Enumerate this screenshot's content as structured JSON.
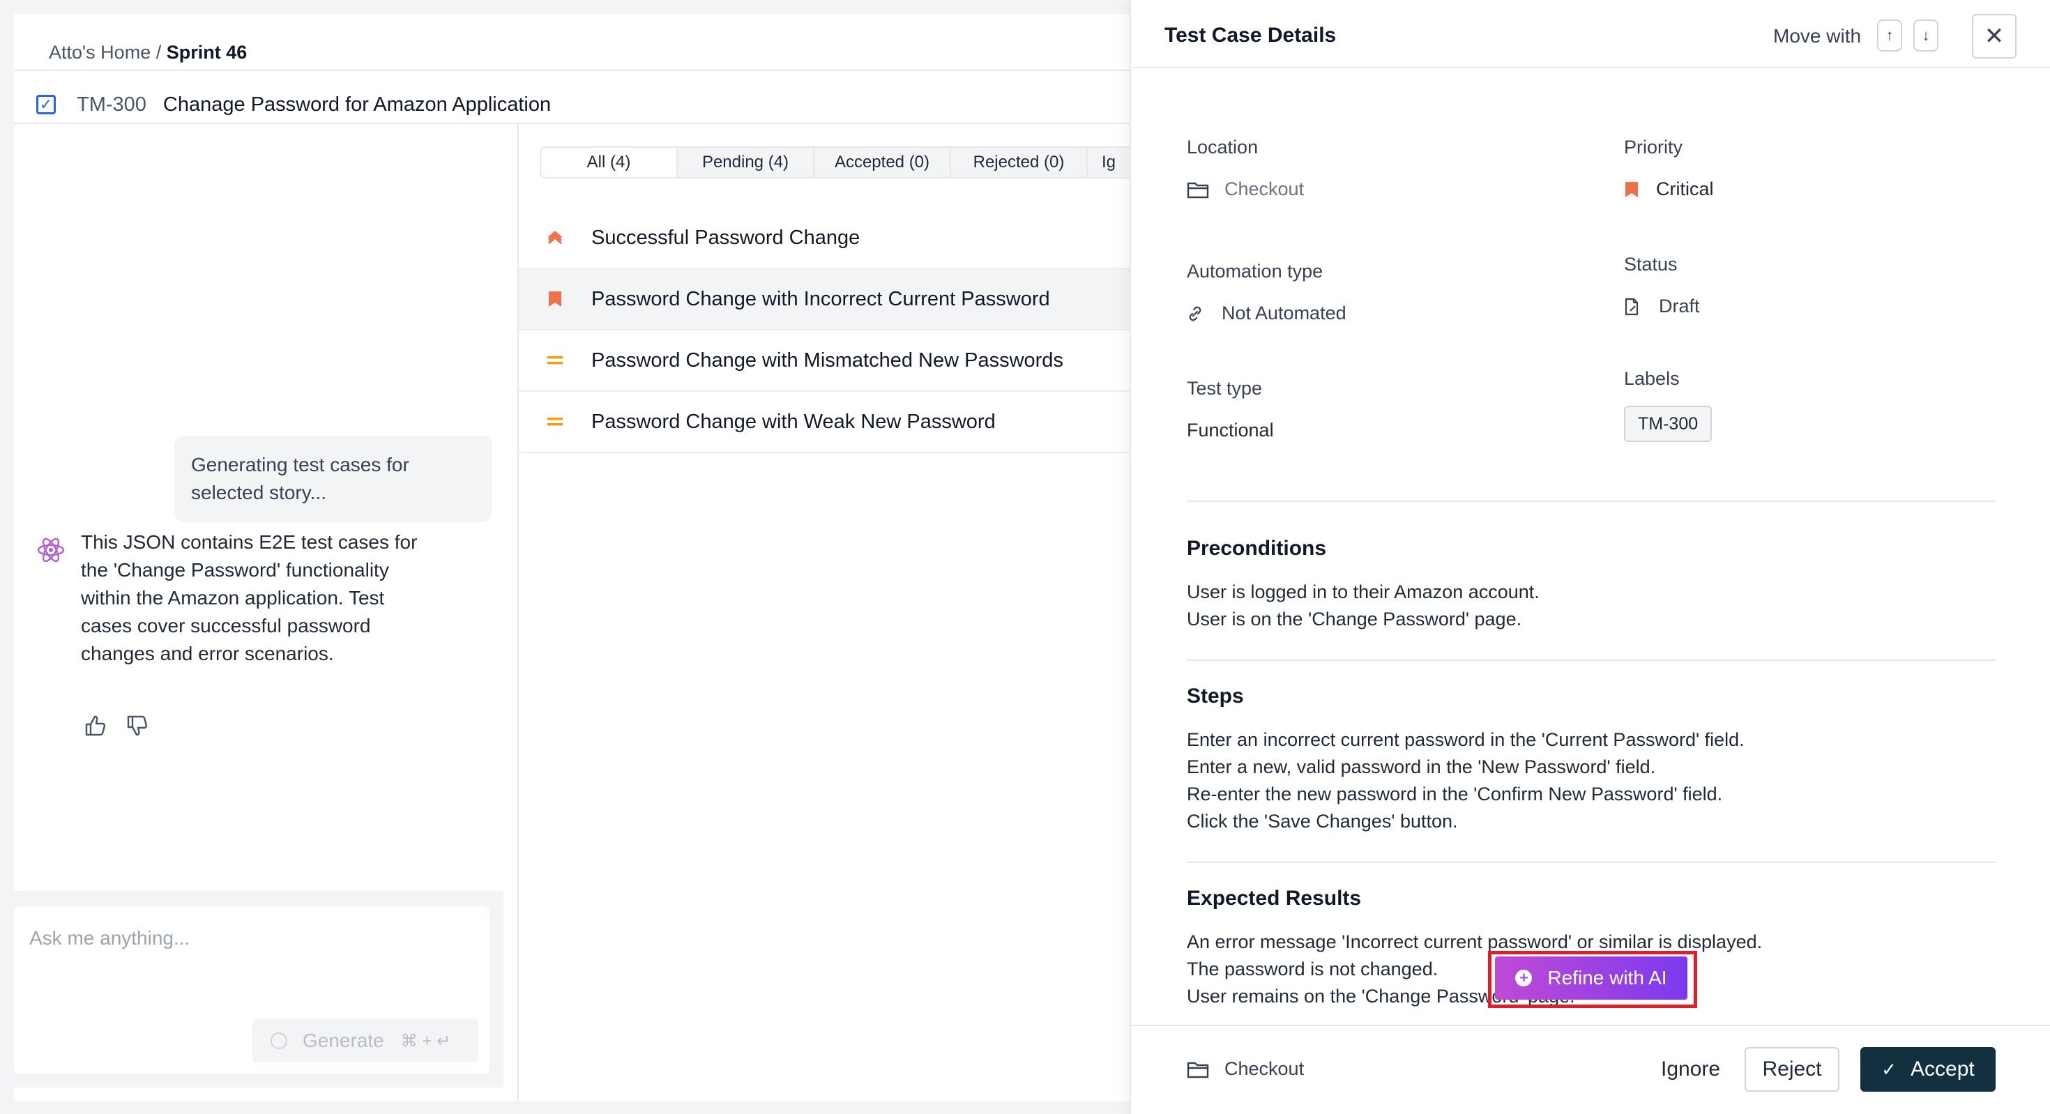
{
  "header": {
    "breadcrumb_home": "Atto's Home",
    "breadcrumb_separator": "/",
    "breadcrumb_current": "Sprint 46"
  },
  "story": {
    "key": "TM-300",
    "title": "Chanage Password for Amazon Application"
  },
  "chat": {
    "user_message": "Generating test cases for selected story...",
    "ai_message": "This JSON contains E2E test cases for the 'Change Password' functionality within the Amazon application. Test cases cover successful password changes and error scenarios.",
    "input_placeholder": "Ask me anything...",
    "generate_label": "Generate",
    "generate_shortcut": "⌘ + ↵"
  },
  "tabs": [
    {
      "label": "All (4)",
      "active": true
    },
    {
      "label": "Pending (4)",
      "active": false
    },
    {
      "label": "Accepted (0)",
      "active": false
    },
    {
      "label": "Rejected (0)",
      "active": false
    },
    {
      "label": "Ig",
      "active": false
    }
  ],
  "test_cases": [
    {
      "title": "Successful Password Change",
      "priority_icon": "double-chevron-up-icon",
      "selected": false
    },
    {
      "title": "Password Change with Incorrect Current Password",
      "priority_icon": "bookmark-icon",
      "selected": true
    },
    {
      "title": "Password Change with Mismatched New Passwords",
      "priority_icon": "equals-icon",
      "selected": false
    },
    {
      "title": "Password Change with Weak New Password",
      "priority_icon": "equals-icon",
      "selected": false
    }
  ],
  "details": {
    "panel_title": "Test Case Details",
    "move_with_label": "Move with",
    "fields": {
      "location_label": "Location",
      "location_value": "Checkout",
      "priority_label": "Priority",
      "priority_value": "Critical",
      "automation_label": "Automation type",
      "automation_value": "Not Automated",
      "status_label": "Status",
      "status_value": "Draft",
      "test_type_label": "Test type",
      "test_type_value": "Functional",
      "labels_label": "Labels",
      "label_chip": "TM-300"
    },
    "preconditions": {
      "title": "Preconditions",
      "lines": [
        "User is logged in to their Amazon account.",
        "User is on the 'Change Password' page."
      ]
    },
    "steps": {
      "title": "Steps",
      "lines": [
        "Enter an incorrect current password in the 'Current Password' field.",
        "Enter a new, valid password in the 'New Password' field.",
        "Re-enter the new password in the 'Confirm New Password' field.",
        "Click the 'Save Changes' button."
      ]
    },
    "expected": {
      "title": "Expected Results",
      "lines": [
        "An error message 'Incorrect current password' or similar is displayed.",
        "The password is not changed.",
        "User remains on the 'Change Password' page."
      ]
    },
    "refine_label": "Refine with AI",
    "footer": {
      "location": "Checkout",
      "ignore_label": "Ignore",
      "reject_label": "Reject",
      "accept_label": "Accept"
    }
  },
  "colors": {
    "accent_dark": "#12303f",
    "priority_critical": "#f0704a",
    "priority_medium": "#f59e0b",
    "checkbox_blue": "#2563eb",
    "highlight_red": "#e11d2a",
    "refine_gradient_start": "#c04ad6",
    "refine_gradient_end": "#7c3aed"
  }
}
